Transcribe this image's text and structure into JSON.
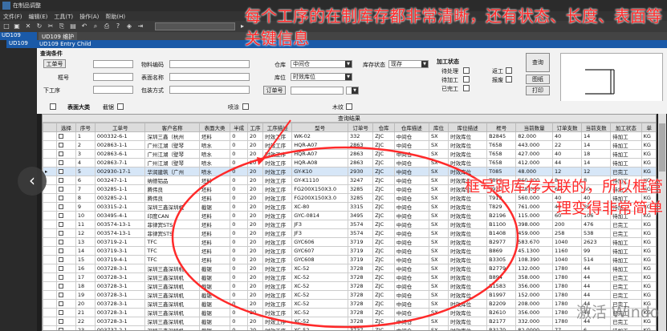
{
  "window": {
    "title": "在制品调整"
  },
  "menu": [
    "文件(F)",
    "编辑(E)",
    "工具(T)",
    "操作(A)",
    "帮助(H)"
  ],
  "left_tabs": [
    "UD109",
    "UD109"
  ],
  "tab_title": "UD109 维护",
  "sub_title": "UD109 Entry Child",
  "form": {
    "section_title": "查询条件",
    "work_order_btn": "工单号",
    "item_code_label": "物料编码",
    "warehouse_label": "仓库",
    "warehouse_value": "中间仓",
    "inventory_status_label": "库存状态",
    "inventory_status_value": "现存",
    "hole_label": "框号",
    "surface_label": "表面名称",
    "bin_label": "库位",
    "bin_value": "时效库位",
    "next_proc_label": "下工序",
    "pack_label": "包装方式",
    "order_btn": "订单号",
    "proc_status_title": "加工状态",
    "st_pending": "待处理",
    "st_processing": "待加工",
    "st_done": "已完工",
    "st_outsource": "返工",
    "st_scrap": "报废",
    "query_btn": "查询",
    "drawing_btn": "图纸",
    "print_btn": "打印",
    "opt_surface_big": "表面大类",
    "opt_cut": "截锯",
    "opt_cut2": "喷涂",
    "opt_wood": "木纹"
  },
  "grid": {
    "caption": "查询结果",
    "headers": [
      "选择",
      "序号",
      "工单号",
      "客户名称",
      "表面大类",
      "半成",
      "工序",
      "工序描述",
      "型号",
      "订单号",
      "仓库",
      "仓库描述",
      "库位",
      "库位描述",
      "框号",
      "当前数量",
      "订单支数",
      "当前支数",
      "加工状态",
      "单"
    ],
    "rows": [
      [
        "",
        "1",
        "000332-6-1",
        "深圳三鑫（杭州",
        "坯料",
        "0",
        "20",
        "时效工序",
        "WK-02",
        "332",
        "ZJC",
        "中间仓",
        "SX",
        "时效库位",
        "B2845",
        "82.000",
        "40",
        "14",
        "待加工",
        "KG"
      ],
      [
        "",
        "2",
        "002863-1-1",
        "广州江湖（壁琴",
        "喷水",
        "0",
        "20",
        "时效工序",
        "HQR-A07",
        "2863",
        "ZJC",
        "中间仓",
        "SX",
        "时效库位",
        "T658",
        "443.000",
        "22",
        "14",
        "待加工",
        "KG"
      ],
      [
        "",
        "3",
        "002863-6-1",
        "广州江湖（壁琴",
        "喷水",
        "0",
        "20",
        "时效工序",
        "HQR-A07",
        "2863",
        "ZJC",
        "中间仓",
        "SX",
        "时效库位",
        "T658",
        "427.000",
        "40",
        "18",
        "待加工",
        "KG"
      ],
      [
        "",
        "4",
        "002863-7-1",
        "广州江湖（壁琴",
        "喷水",
        "0",
        "20",
        "时效工序",
        "HQR-A08",
        "2863",
        "ZJC",
        "中间仓",
        "SX",
        "时效库位",
        "T658",
        "412.000",
        "44",
        "14",
        "待加工",
        "KG"
      ],
      [
        "",
        "5",
        "002930-17-1",
        "华润建筑（广州",
        "喷水",
        "0",
        "20",
        "时效工序",
        "GY-K10",
        "2930",
        "ZJC",
        "中间仓",
        "SX",
        "时效库位",
        "T085",
        "48.000",
        "12",
        "12",
        "已完工",
        "KG"
      ],
      [
        "",
        "6",
        "003247-1-1",
        "纳德铝品",
        "坯料",
        "0",
        "20",
        "时效工序",
        "GY-K1110",
        "3247",
        "ZJC",
        "中间仓",
        "SX",
        "时效库位",
        "T890",
        "360.000",
        "8",
        "8",
        "待加工",
        "KG"
      ],
      [
        "",
        "7",
        "003285-1-1",
        "腾伟良",
        "坯料",
        "0",
        "20",
        "时效工序",
        "FG200X150X3.0",
        "3285",
        "ZJC",
        "中间仓",
        "SX",
        "时效库位",
        "T920",
        "578.000",
        "60",
        "60",
        "待加工",
        "KG"
      ],
      [
        "",
        "8",
        "003285-2-1",
        "腾伟良",
        "坯料",
        "0",
        "20",
        "时效工序",
        "FG200X150X3.0",
        "3285",
        "ZJC",
        "中间仓",
        "SX",
        "时效库位",
        "T919",
        "560.000",
        "40",
        "40",
        "待加工",
        "KG"
      ],
      [
        "",
        "9",
        "003315-2-1",
        "深圳三鑫深圳机",
        "截锯",
        "0",
        "20",
        "时效工序",
        "XC-80",
        "3315",
        "ZJC",
        "中间仓",
        "SX",
        "时效库位",
        "T829",
        "761.000",
        "40",
        "36",
        "待加工",
        "KG"
      ],
      [
        "",
        "10",
        "003495-4-1",
        "印度CAN",
        "坯料",
        "0",
        "20",
        "时效工序",
        "GYC-0814",
        "3495",
        "ZJC",
        "中间仓",
        "SX",
        "时效库位",
        "B2196",
        "115.000",
        "60",
        "106",
        "待加工",
        "KG"
      ],
      [
        "",
        "11",
        "003574-13-1",
        "菲律宾STS",
        "坯料",
        "0",
        "20",
        "时效工序",
        "JF3",
        "3574",
        "ZJC",
        "中间仓",
        "SX",
        "时效库位",
        "B1100",
        "398.000",
        "200",
        "476",
        "已完工",
        "KG"
      ],
      [
        "",
        "12",
        "003574-13-1",
        "菲律宾STS",
        "坯料",
        "0",
        "20",
        "时效工序",
        "JF3",
        "3574",
        "ZJC",
        "中间仓",
        "SX",
        "时效库位",
        "B1408",
        "459.000",
        "258",
        "538",
        "已完工",
        "KG"
      ],
      [
        "",
        "13",
        "003719-2-1",
        "TFC",
        "坯料",
        "0",
        "20",
        "时效工序",
        "GYC606",
        "3719",
        "ZJC",
        "中间仓",
        "SX",
        "时效库位",
        "B2977",
        "583.670",
        "1040",
        "2623",
        "待加工",
        "KG"
      ],
      [
        "",
        "14",
        "003719-3-1",
        "TFC",
        "坯料",
        "0",
        "20",
        "时效工序",
        "GYC607",
        "3719",
        "ZJC",
        "中间仓",
        "SX",
        "时效库位",
        "B869",
        "45.1300",
        "1160",
        "99",
        "待加工",
        "KG"
      ],
      [
        "",
        "15",
        "003719-4-1",
        "TFC",
        "坯料",
        "0",
        "20",
        "时效工序",
        "GYC608",
        "3719",
        "ZJC",
        "中间仓",
        "SX",
        "时效库位",
        "B3305",
        "108.390",
        "1040",
        "514",
        "待加工",
        "KG"
      ],
      [
        "",
        "16",
        "003728-3-1",
        "深圳三鑫深圳机",
        "截锯",
        "0",
        "20",
        "时效工序",
        "XC-52",
        "3728",
        "ZJC",
        "中间仓",
        "SX",
        "时效库位",
        "B2779",
        "132.000",
        "1780",
        "44",
        "待加工",
        "KG"
      ],
      [
        "",
        "17",
        "003728-3-1",
        "深圳三鑫深圳机",
        "截锯",
        "0",
        "20",
        "时效工序",
        "XC-52",
        "3728",
        "ZJC",
        "中间仓",
        "SX",
        "时效库位",
        "B894",
        "358.000",
        "1780",
        "44",
        "已完工",
        "KG"
      ],
      [
        "",
        "18",
        "003728-3-1",
        "深圳三鑫深圳机",
        "截锯",
        "0",
        "20",
        "时效工序",
        "XC-52",
        "3728",
        "ZJC",
        "中间仓",
        "SX",
        "时效库位",
        "B1583",
        "356.000",
        "1780",
        "44",
        "已完工",
        "KG"
      ],
      [
        "",
        "19",
        "003728-3-1",
        "深圳三鑫深圳机",
        "截锯",
        "0",
        "20",
        "时效工序",
        "XC-52",
        "3728",
        "ZJC",
        "中间仓",
        "SX",
        "时效库位",
        "B1997",
        "152.000",
        "1780",
        "44",
        "已完工",
        "KG"
      ],
      [
        "",
        "20",
        "003728-3-1",
        "深圳三鑫深圳机",
        "截锯",
        "0",
        "20",
        "时效工序",
        "XC-52",
        "3728",
        "ZJC",
        "中间仓",
        "SX",
        "时效库位",
        "B2209",
        "208.000",
        "1780",
        "44",
        "已完工",
        "KG"
      ],
      [
        "",
        "21",
        "003728-3-1",
        "深圳三鑫深圳机",
        "截锯",
        "0",
        "20",
        "时效工序",
        "XC-52",
        "3728",
        "ZJC",
        "中间仓",
        "SX",
        "时效库位",
        "B2610",
        "356.000",
        "1780",
        "44",
        "已完工",
        "KG"
      ],
      [
        "",
        "22",
        "003728-3-1",
        "深圳三鑫深圳机",
        "截锯",
        "0",
        "20",
        "时效工序",
        "XC-52",
        "3728",
        "ZJC",
        "中间仓",
        "SX",
        "时效库位",
        "B2177",
        "332.000",
        "1780",
        "44",
        "已完工",
        "KG"
      ],
      [
        "",
        "23",
        "003737-2-1",
        "深圳三鑫深圳机",
        "截锯",
        "0",
        "20",
        "时效工序",
        "XC-52",
        "3737",
        "ZJC",
        "中间仓",
        "SX",
        "时效库位",
        "B3170",
        "82.0000",
        "77",
        "6",
        "待加工",
        "KG"
      ]
    ],
    "highlight_row": 4
  },
  "annotation_top": "每个工序的在制库存都非常清晰，还有状态、长度、表面等关键信息",
  "annotation_right": "框号跟库存关联的，所以框管理变得非常简单",
  "watermark": "激活 Windo",
  "colors": {
    "annotation": "#ff2a2a",
    "tab_active": "#1a5aa8",
    "row_highlight": "#d6e6f7"
  }
}
